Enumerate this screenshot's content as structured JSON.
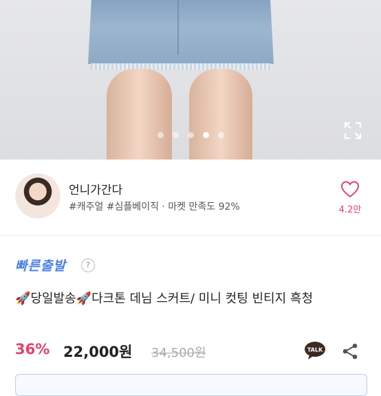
{
  "carousel": {
    "pages": 5,
    "active_index": 3
  },
  "seller": {
    "name": "언니가간다",
    "tags": "#캐주얼 #심플베이직 · 마켓 만족도 92%",
    "likes": "4.2만"
  },
  "badge": {
    "fast_shipping": "빠른출발",
    "help": "?"
  },
  "product": {
    "title_part1": "당일발송",
    "title_part2": "다크톤 데님 스커트/ 미니 컷팅 빈티지 흑청",
    "discount": "36%",
    "price": "22,000원",
    "original_price": "34,500원"
  },
  "talk_label": "TALK",
  "colors": {
    "accent": "#e5426b",
    "fast": "#4b7fe5"
  }
}
